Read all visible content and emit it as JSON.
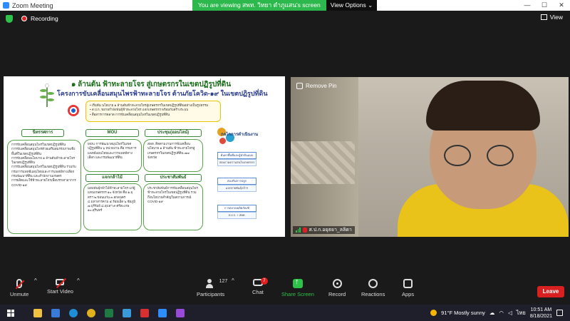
{
  "window": {
    "title": "Zoom Meeting",
    "share_banner": "You are viewing สพท. วิทยา ตำภูแสน's screen",
    "view_options": "View Options"
  },
  "topbar": {
    "recording_label": "Recording",
    "view_label": "View"
  },
  "slide": {
    "title_line1": "๑ ล้านต้น ฟ้าทะลายโจร สู่เกษตรกรในเขตปฏิรูปที่ดิน",
    "title_line2": "โครงการขับเคลื่อนสมุนไพรฟ้าทะลายโจร ต้านภัยโควิด-๑๙ ในเขตปฏิรูปที่ดิน",
    "objectives": [
      "เริ่มต้น นโยบาย ๑ ล้านต้นฟ้าทะลายโจรสู่เกษตรกรในเขตปฏิรูปที่ดินอย่างเป็นรูปธรรม",
      "ส.ป.ก. ขยายกำลังพันธุ์ฟ้าทะลายโจร แจกเกษตรกร พร้อมกับสร้างระบบ",
      "สื่อสารการตลาด การขับเคลื่อนสมุนไพรในเขตปฏิรูปที่ดิน"
    ],
    "sections": [
      {
        "tag": "นิทรรศการ",
        "items": [
          "การขับเคลื่อนสมุนไพรในเขตปฏิรูปที่ดิน",
          "การขับเคลื่อนสมุนไพรด้วยเสริมสมรรถภาพเชิงพื้นที่ในเขตปฏิรูปที่ดิน",
          "การขับเคลื่อนนโยบาย ๑ ล้านต้นฟ้าทะลายโจร ในเขตปฏิรูปที่ดิน",
          "การขับเคลื่อนสมุนไพรในเขตปฏิรูปที่ดิน ร่วมกับ กรมการแพทย์แผนไทยและการแพทย์ทางเลือก",
          "กรมพัฒนาที่ดิน และสำนักงานเกษตร",
          "การผลิตและใช้ฟ้าทะลายโจรเพื่อบรรเทาอาการ COVID-๑๙"
        ]
      },
      {
        "tag": "MOU",
        "items": [
          "MOU การพัฒนาสมุนไพรในเขตปฏิรูปที่ดิน ๖ หน่วยงาน คือ กรมการแพทย์แผนไทยและการแพทย์ทางเลือก และกรมพัฒนาที่ดิน"
        ]
      },
      {
        "tag": "แจกกล้าไม้",
        "items": [
          "มอบพันธุ์กล้าไม้ฟ้าทะลายโจร แก่ผู้แทนเกษตรกร ๑๐ จังหวัด คือ ๑.อุดรฯ ๒.ขอนแก่น ๓.สกลนคร ๔.มหาสารคาม ๕.ร้อยเอ็ด ๖.ชัยภูมิ ๗.บุรีรัมย์ ๘.อุบลฯ ๙.ศรีสะเกษ ๑๐.สุรินทร์"
        ]
      },
      {
        "tag": "ประชุม(ออนไลน์)",
        "items": [
          "สพท. ติดตามงานการขับเคลื่อนนโยบาย ๑ ล้านต้น ฟ้าทะลายโจรสู่เกษตรกรในเขตปฏิรูปที่ดิน ๗๗ จังหวัด"
        ]
      },
      {
        "tag": "ประชาสัมพันธ์",
        "items": [
          "ประชาสัมพันธ์การขับเคลื่อนสมุนไพรฟ้าทะลายโจรในเขตปฏิรูปที่ดิน รวมถึงนโยบายสำคัญในสถานการณ์ COVID-๑๙"
        ]
      }
    ],
    "process": {
      "title": "กลไกการดำเนินงาน",
      "steps": [
        {
          "label": "ค้นหาพื้นที่และผู้นำต้นแบบ",
          "sub": "สอบถามความสนใจเกษตรกร"
        },
        {
          "label": "ส่งเสริมการปลูก",
          "sub": "แจกจ่ายพันธุ์กล้าฯ"
        },
        {
          "label": "การตลาด/ผลิตภัณฑ์",
          "sub": "ส.ป.ก. + สพท."
        }
      ]
    }
  },
  "video": {
    "remove_pin": "Remove Pin",
    "participant_name": "ส.ป.ก.อยุธยา_ลลิตา"
  },
  "toolbar": {
    "unmute": "Unmute",
    "start_video": "Start Video",
    "participants": "Participants",
    "participants_count": "127",
    "chat": "Chat",
    "chat_badge": "7",
    "share_screen": "Share Screen",
    "record": "Record",
    "reactions": "Reactions",
    "apps": "Apps",
    "leave": "Leave"
  },
  "taskbar": {
    "weather": "91°F  Mostly sunny",
    "language": "ไทย",
    "time": "10:51 AM",
    "date": "8/18/2021"
  },
  "colors": {
    "share_green": "#2db84d",
    "leave_red": "#d82020",
    "record_red": "#e02020",
    "slide_green": "#5aa34a",
    "slide_yellow": "#f2c200"
  }
}
